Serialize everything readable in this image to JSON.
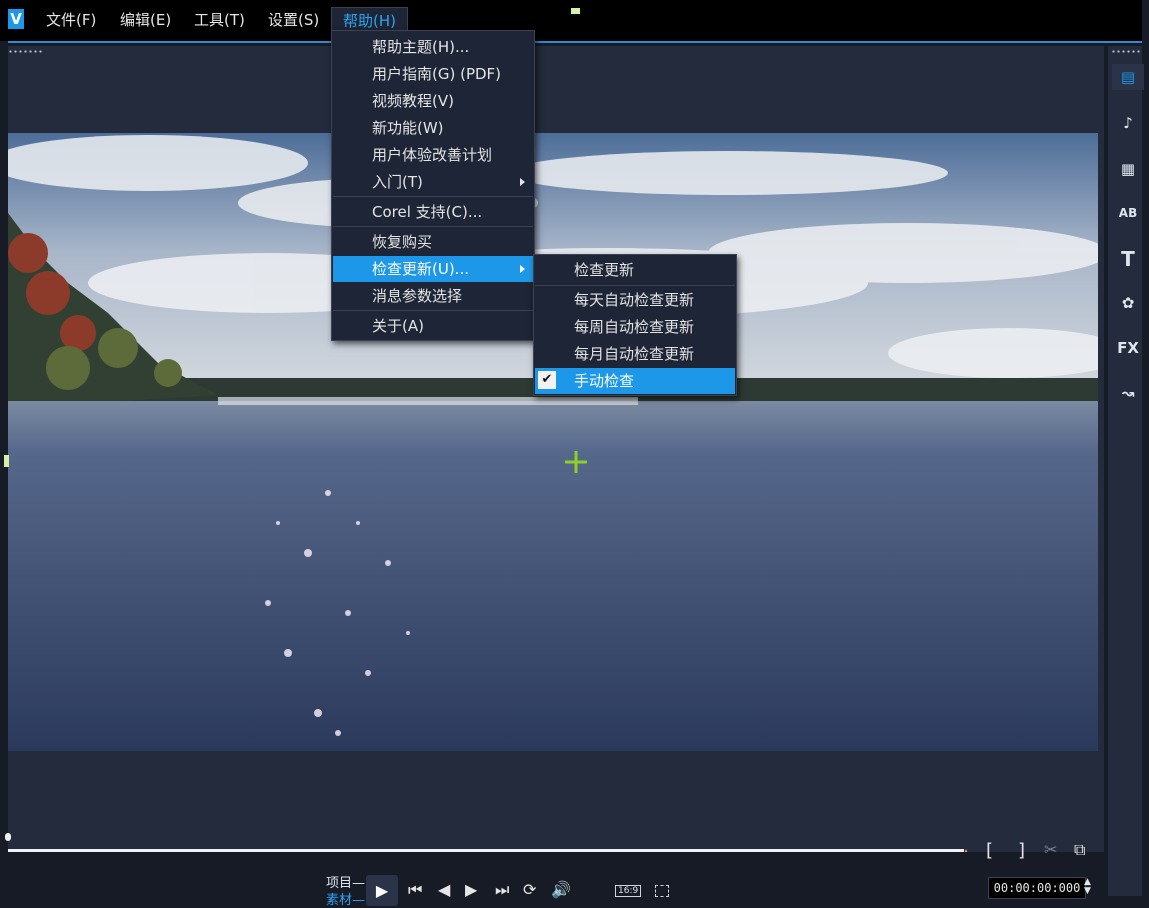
{
  "menubar": {
    "logo": "V",
    "items": [
      {
        "label": "文件(F)"
      },
      {
        "label": "编辑(E)"
      },
      {
        "label": "工具(T)"
      },
      {
        "label": "设置(S)"
      },
      {
        "label": "帮助(H)"
      }
    ]
  },
  "help_menu": {
    "items": [
      "帮助主题(H)...",
      "用户指南(G) (PDF)",
      "视频教程(V)",
      "新功能(W)",
      "用户体验改善计划",
      "入门(T)",
      "Corel 支持(C)...",
      "恢复购买",
      "检查更新(U)...",
      "消息参数选择",
      "关于(A)"
    ]
  },
  "update_submenu": {
    "items": [
      "检查更新",
      "每天自动检查更新",
      "每周自动检查更新",
      "每月自动检查更新",
      "手动检查"
    ],
    "checked": "手动检查"
  },
  "player": {
    "mode_label_project": "项目—",
    "mode_label_clip": "素材—",
    "aspect_ratio": "16:9",
    "timecode": "00:00:00:000"
  },
  "right_toolbar": {
    "icons": [
      "media-icon",
      "audio-icon",
      "instant-project-icon",
      "transition-icon",
      "title-icon",
      "graphics-icon",
      "filter-icon",
      "path-icon"
    ],
    "labels": {
      "ab": "AB",
      "t": "T",
      "fx": "FX"
    }
  },
  "colors": {
    "accent": "#1d98e8",
    "panel": "#232b3d",
    "menu_bg": "#1d2536"
  }
}
